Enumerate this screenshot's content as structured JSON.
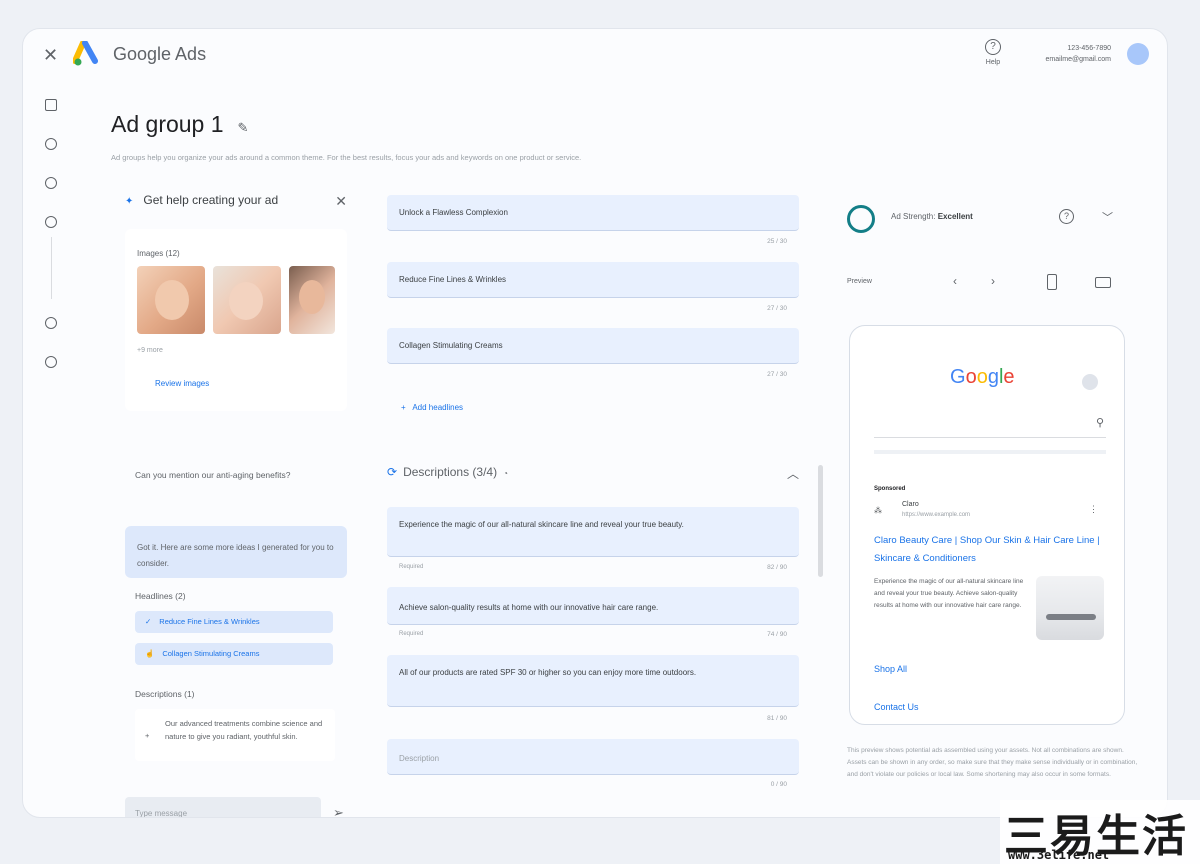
{
  "app": {
    "brand": "Google Ads",
    "help_label": "Help",
    "account_line1": "123-456-7890",
    "account_line2": "emailme@gmail.com"
  },
  "page": {
    "title": "Ad group 1",
    "description": "Ad groups help you organize your ads around a common theme. For the best results, focus your ads and keywords on one product or service."
  },
  "assistant": {
    "title": "Get help creating your ad",
    "images_title": "Images (12)",
    "images_more": "+9 more",
    "review_images": "Review images",
    "question": "Can you mention our anti-aging benefits?",
    "reply": "Got it. Here are some more ideas I generated for you to consider.",
    "headlines_title": "Headlines (2)",
    "headline_suggestions": [
      "Reduce Fine Lines & Wrinkles",
      "Collagen Stimulating Creams"
    ],
    "descriptions_title": "Descriptions (1)",
    "description_suggestion": "Our advanced treatments combine science and nature to give you radiant, youthful skin.",
    "message_placeholder": "Type message"
  },
  "headlines": [
    {
      "text": "Unlock a Flawless Complexion",
      "count": "25 / 30"
    },
    {
      "text": "Reduce Fine Lines & Wrinkles",
      "count": "27 / 30"
    },
    {
      "text": "Collagen Stimulating Creams",
      "count": "27 / 30"
    }
  ],
  "add_headline": "Add headlines",
  "descriptions_section": {
    "title": "Descriptions (3/4)"
  },
  "descriptions": [
    {
      "text": "Experience the magic of our all-natural skincare line and reveal your true beauty.",
      "label": "Required",
      "count": "82 / 90"
    },
    {
      "text": "Achieve salon-quality results at home with our innovative hair care range.",
      "label": "Required",
      "count": "74 / 90"
    },
    {
      "text": "All of our products are rated SPF 30 or higher so you can enjoy more time outdoors.",
      "label": "",
      "count": "81 / 90"
    },
    {
      "text": "Description",
      "label": "",
      "count": "0 / 90"
    }
  ],
  "strength": {
    "label": "Ad Strength:",
    "value": "Excellent"
  },
  "preview": {
    "label": "Preview",
    "sponsored": "Sponsored",
    "advertiser": "Claro",
    "url": "https://www.example.com",
    "ad_title": "Claro Beauty Care | Shop Our Skin & Hair Care Line | Skincare & Conditioners",
    "ad_body": "Experience the magic of our all-natural skincare line and reveal your true beauty. Achieve salon-quality results at home with our innovative hair care range.",
    "sitelinks": [
      "Shop All",
      "Contact Us"
    ],
    "disclaimer": "This preview shows potential ads assembled using your assets. Not all combinations are shown. Assets can be shown in any order, so make sure that they make sense individually or in combination, and don't violate our policies or local law. Some shortening may also occur in some formats."
  },
  "watermark": {
    "cn": "三易生活",
    "url": "www.3elife.net"
  }
}
